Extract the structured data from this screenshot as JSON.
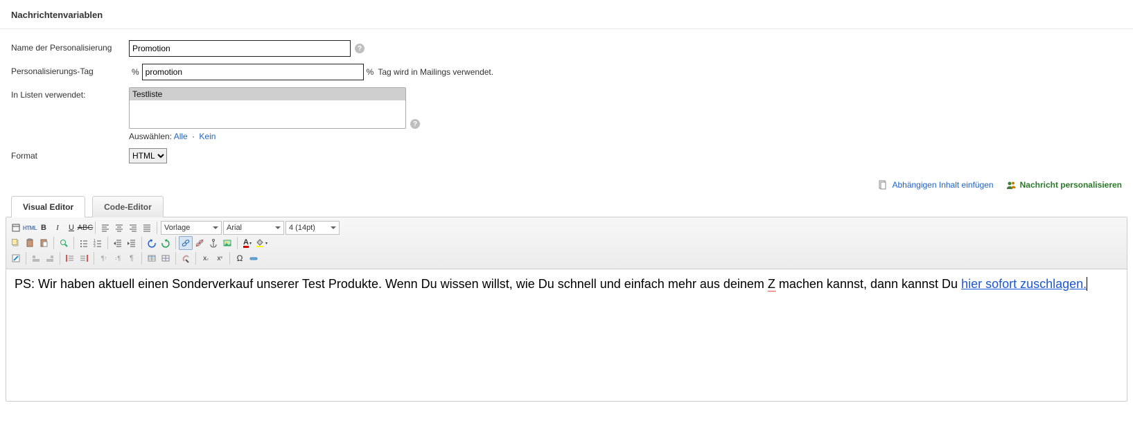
{
  "page_title": "Nachrichtenvariablen",
  "form": {
    "name_label": "Name der Personalisierung",
    "name_value": "Promotion",
    "tag_label": "Personalisierungs-Tag",
    "tag_prefix": "%",
    "tag_value": "promotion",
    "tag_suffix": "%",
    "tag_hint": "Tag wird in Mailings verwendet.",
    "lists_label": "In Listen verwendet:",
    "lists_options": [
      "Testliste"
    ],
    "lists_select_label": "Auswählen:",
    "lists_select_all": "Alle",
    "lists_select_none": "Kein",
    "format_label": "Format",
    "format_value": "HTML"
  },
  "actions": {
    "insert_dependent": "Abhängigen Inhalt einfügen",
    "personalize": "Nachricht personalisieren"
  },
  "tabs": {
    "visual": "Visual Editor",
    "code": "Code-Editor"
  },
  "toolbar": {
    "html": "HTML",
    "template_sel": "Vorlage",
    "font_sel": "Arial",
    "size_sel": "4 (14pt)"
  },
  "editor": {
    "text_before": "PS: Wir haben aktuell einen Sonderverkauf unserer Test Produkte. Wenn Du wissen willst, wie Du schnell und einfach mehr aus deinem ",
    "spell1": "Z",
    "text_mid": " machen kannst, dann kannst Du ",
    "link_text": "hier sofort zuschlagen."
  }
}
